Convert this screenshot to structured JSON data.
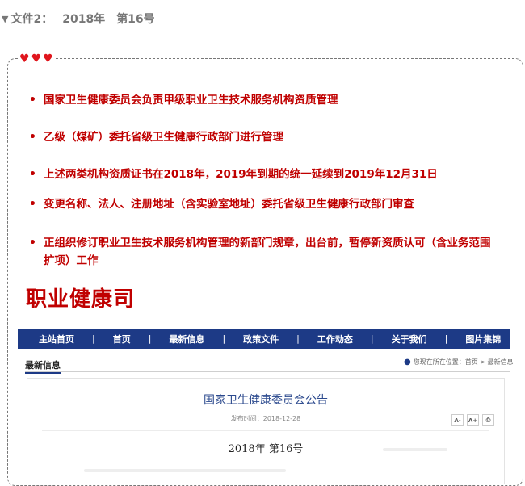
{
  "header": {
    "triangle": "▼",
    "label": "文件2：",
    "year": "2018年",
    "number": "第16号"
  },
  "bullets": [
    "国家卫生健康委员会负责甲级职业卫生技术服务机构资质管理",
    "乙级（煤矿）委托省级卫生健康行政部门进行管理",
    "上述两类机构资质证书在2018年，2019年到期的统一延续到2019年12月31日",
    "变更名称、法人、注册地址（含实验室地址）委托省级卫生健康行政部门审查",
    "正组织修订职业卫生技术服务机构管理的新部门规章，出台前，暂停新资质认可（含业务范围扩项）工作"
  ],
  "department_title": "职业健康司",
  "nav": {
    "items": [
      "主站首页",
      "首页",
      "最新信息",
      "政策文件",
      "工作动态",
      "关于我们",
      "图片集锦"
    ],
    "separator": "|"
  },
  "latest_section": {
    "label": "最新信息",
    "location": "您现在所在位置：首页 > 最新信息"
  },
  "article": {
    "title": "国家卫生健康委员会公告",
    "pub_date": "发布时间：2018-12-28",
    "font_tools": [
      "A-",
      "A+",
      "⎙"
    ],
    "doc_number": "2018年  第16号"
  },
  "colors": {
    "accent_red": "#c00000",
    "heart_red": "#e0161d",
    "nav_blue": "#1d3a86",
    "header_gray": "#777777"
  },
  "icons": {
    "heart": "heart-icon",
    "pin": "location-pin-icon",
    "bullet": "bullet-dot-icon"
  }
}
